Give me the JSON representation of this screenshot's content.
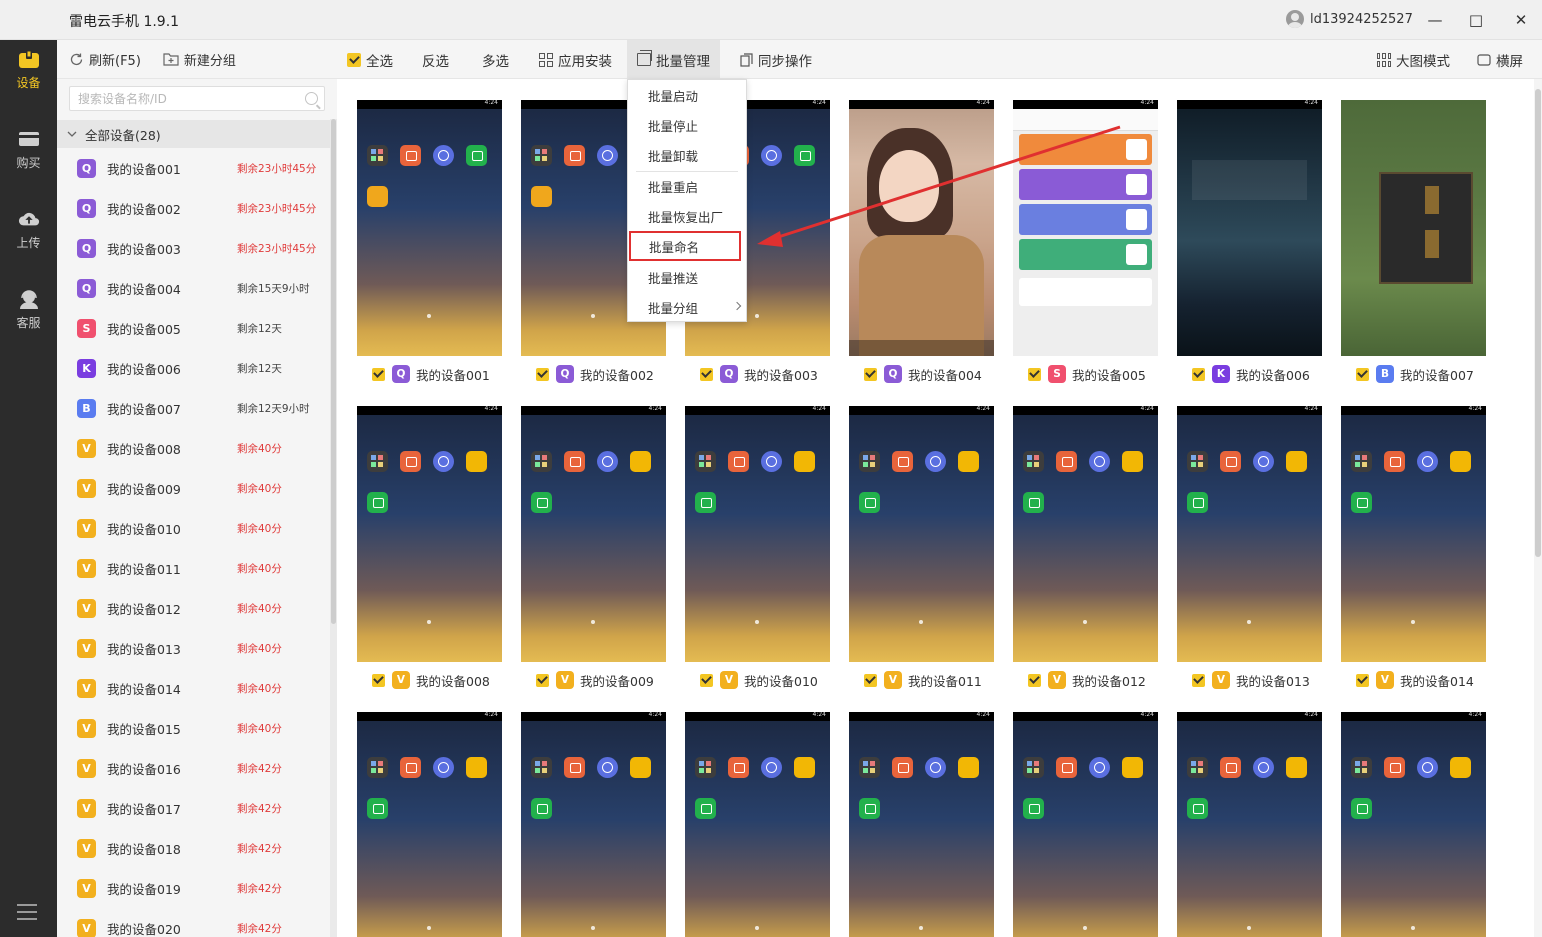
{
  "window": {
    "title": "雷电云手机 1.9.1",
    "user_id": "ld13924252527",
    "minimize": "—",
    "maximize": "□",
    "close": "✕"
  },
  "rail": {
    "items": [
      {
        "label": "设备",
        "icon": "device-icon"
      },
      {
        "label": "购买",
        "icon": "card-icon"
      },
      {
        "label": "上传",
        "icon": "upload-cloud-icon"
      },
      {
        "label": "客服",
        "icon": "support-icon"
      }
    ],
    "menu_icon": "hamburger-icon"
  },
  "panel": {
    "refresh_label": "刷新(F5)",
    "new_group_label": "新建分组",
    "search_placeholder": "搜索设备名称/ID",
    "group_label": "全部设备(28)"
  },
  "devices": [
    {
      "badge": "Q",
      "color": "#8b5bd6",
      "name": "我的设备001",
      "time": "剩余23小时45分",
      "red": true
    },
    {
      "badge": "Q",
      "color": "#8b5bd6",
      "name": "我的设备002",
      "time": "剩余23小时45分",
      "red": true
    },
    {
      "badge": "Q",
      "color": "#8b5bd6",
      "name": "我的设备003",
      "time": "剩余23小时45分",
      "red": true
    },
    {
      "badge": "Q",
      "color": "#8b5bd6",
      "name": "我的设备004",
      "time": "剩余15天9小时",
      "red": false
    },
    {
      "badge": "S",
      "color": "#f0506e",
      "name": "我的设备005",
      "time": "剩余12天",
      "red": false
    },
    {
      "badge": "K",
      "color": "#7a3de0",
      "name": "我的设备006",
      "time": "剩余12天",
      "red": false
    },
    {
      "badge": "B",
      "color": "#5a7cf0",
      "name": "我的设备007",
      "time": "剩余12天9小时",
      "red": false
    },
    {
      "badge": "V",
      "color": "#f2b01e",
      "name": "我的设备008",
      "time": "剩余40分",
      "red": true
    },
    {
      "badge": "V",
      "color": "#f2b01e",
      "name": "我的设备009",
      "time": "剩余40分",
      "red": true
    },
    {
      "badge": "V",
      "color": "#f2b01e",
      "name": "我的设备010",
      "time": "剩余40分",
      "red": true
    },
    {
      "badge": "V",
      "color": "#f2b01e",
      "name": "我的设备011",
      "time": "剩余40分",
      "red": true
    },
    {
      "badge": "V",
      "color": "#f2b01e",
      "name": "我的设备012",
      "time": "剩余40分",
      "red": true
    },
    {
      "badge": "V",
      "color": "#f2b01e",
      "name": "我的设备013",
      "time": "剩余40分",
      "red": true
    },
    {
      "badge": "V",
      "color": "#f2b01e",
      "name": "我的设备014",
      "time": "剩余40分",
      "red": true
    },
    {
      "badge": "V",
      "color": "#f2b01e",
      "name": "我的设备015",
      "time": "剩余40分",
      "red": true
    },
    {
      "badge": "V",
      "color": "#f2b01e",
      "name": "我的设备016",
      "time": "剩余42分",
      "red": true
    },
    {
      "badge": "V",
      "color": "#f2b01e",
      "name": "我的设备017",
      "time": "剩余42分",
      "red": true
    },
    {
      "badge": "V",
      "color": "#f2b01e",
      "name": "我的设备018",
      "time": "剩余42分",
      "red": true
    },
    {
      "badge": "V",
      "color": "#f2b01e",
      "name": "我的设备019",
      "time": "剩余42分",
      "red": true
    },
    {
      "badge": "V",
      "color": "#f2b01e",
      "name": "我的设备020",
      "time": "剩余42分",
      "red": true
    }
  ],
  "toolbar": {
    "select_all": "全选",
    "invert": "反选",
    "multi": "多选",
    "app_install": "应用安装",
    "batch_manage": "批量管理",
    "sync": "同步操作",
    "big_view": "大图模式",
    "landscape": "横屏"
  },
  "batch_menu": {
    "items": [
      "批量启动",
      "批量停止",
      "批量卸载",
      "批量重启",
      "批量恢复出厂",
      "批量命名",
      "批量推送",
      "批量分组"
    ],
    "highlighted": "批量命名"
  },
  "grid": {
    "row1": [
      {
        "badge": "Q",
        "color": "#8b5bd6",
        "name": "我的设备001",
        "screen": "home"
      },
      {
        "badge": "Q",
        "color": "#8b5bd6",
        "name": "我的设备002",
        "screen": "home"
      },
      {
        "badge": "Q",
        "color": "#8b5bd6",
        "name": "我的设备003",
        "screen": "home"
      },
      {
        "badge": "Q",
        "color": "#8b5bd6",
        "name": "我的设备004",
        "screen": "photo"
      },
      {
        "badge": "S",
        "color": "#f0506e",
        "name": "我的设备005",
        "screen": "tools"
      },
      {
        "badge": "K",
        "color": "#7a3de0",
        "name": "我的设备006",
        "screen": "game1"
      },
      {
        "badge": "B",
        "color": "#5a7cf0",
        "name": "我的设备007",
        "screen": "game2"
      }
    ],
    "row2": [
      {
        "badge": "V",
        "color": "#f2b01e",
        "name": "我的设备008"
      },
      {
        "badge": "V",
        "color": "#f2b01e",
        "name": "我的设备009"
      },
      {
        "badge": "V",
        "color": "#f2b01e",
        "name": "我的设备010"
      },
      {
        "badge": "V",
        "color": "#f2b01e",
        "name": "我的设备011"
      },
      {
        "badge": "V",
        "color": "#f2b01e",
        "name": "我的设备012"
      },
      {
        "badge": "V",
        "color": "#f2b01e",
        "name": "我的设备013"
      },
      {
        "badge": "V",
        "color": "#f2b01e",
        "name": "我的设备014"
      }
    ]
  },
  "colors": {
    "accent": "#f3c623",
    "rail_bg": "#2c2c2c",
    "expiry_red": "#e03b3b",
    "annotation_red": "#e03030"
  }
}
